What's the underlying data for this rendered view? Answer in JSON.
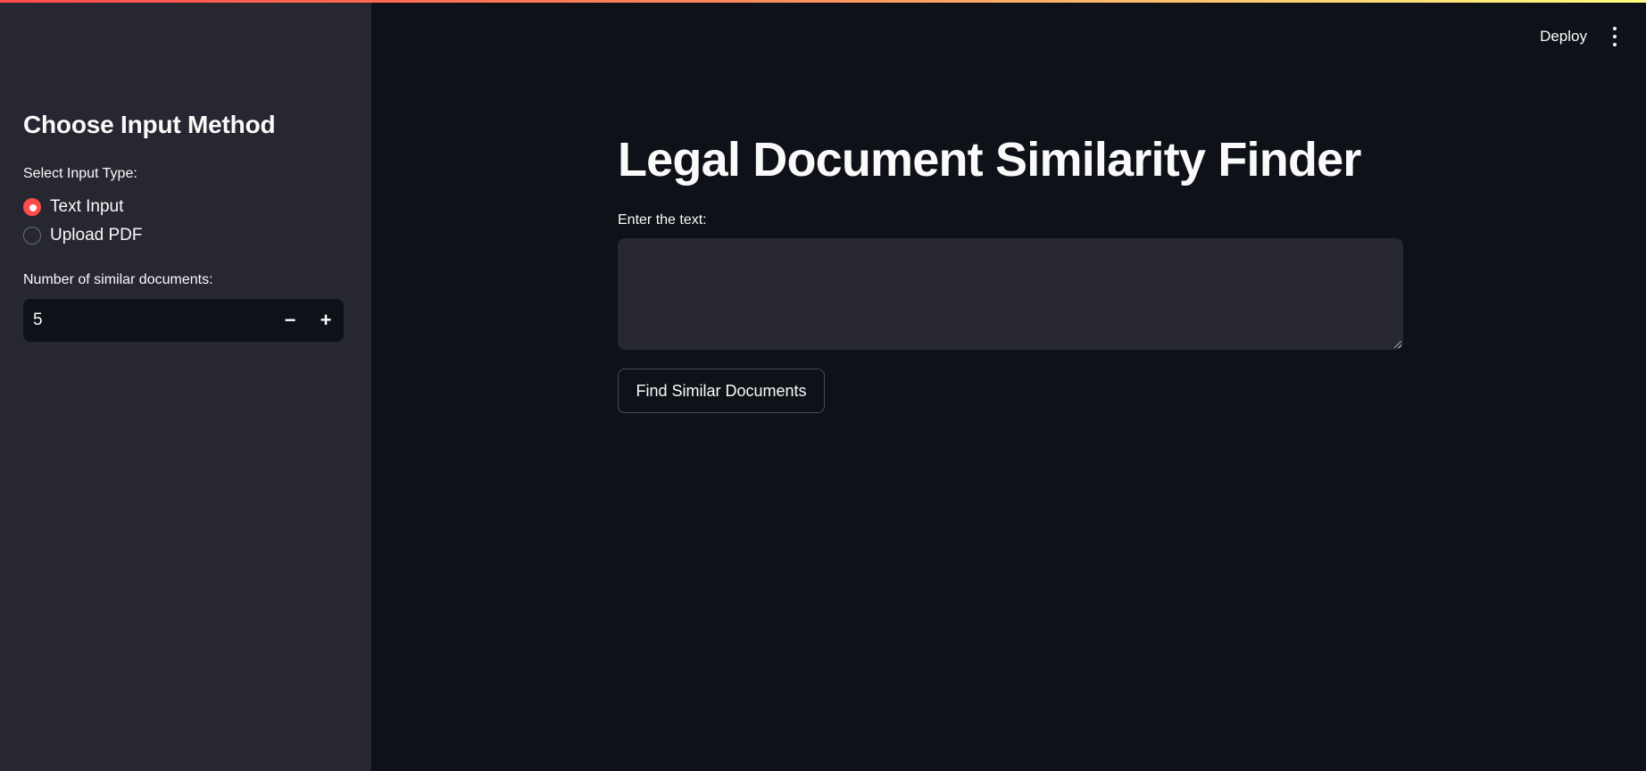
{
  "header": {
    "deploy_label": "Deploy",
    "menu_icon": "more-vertical-icon"
  },
  "sidebar": {
    "title": "Choose Input Method",
    "input_type": {
      "label": "Select Input Type:",
      "options": [
        {
          "label": "Text Input",
          "selected": true
        },
        {
          "label": "Upload PDF",
          "selected": false
        }
      ]
    },
    "num_docs": {
      "label": "Number of similar documents:",
      "value": "5",
      "decrement": "−",
      "increment": "+"
    }
  },
  "main": {
    "title": "Legal Document Similarity Finder",
    "text_label": "Enter the text:",
    "text_value": "",
    "find_button": "Find Similar Documents"
  },
  "colors": {
    "accent": "#ff4b4b",
    "background": "#0e1117",
    "sidebar": "#262730",
    "text": "#fafafa"
  }
}
